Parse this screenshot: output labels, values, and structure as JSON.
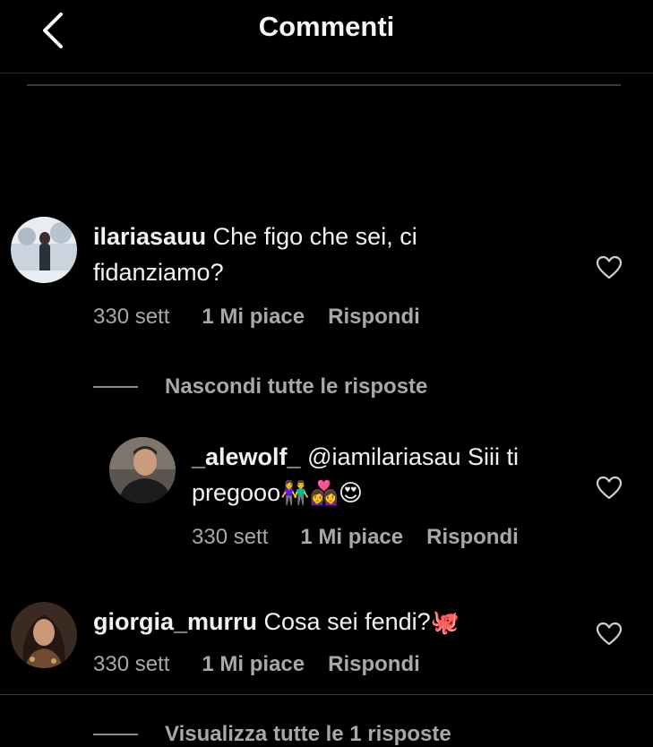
{
  "header": {
    "title": "Commenti"
  },
  "comments": [
    {
      "username": "ilariasauu",
      "text": "Che figo che sei, ci fidanziamo?",
      "time": "330 sett",
      "likes": "1 Mi piace",
      "reply": "Rispondi",
      "replies_toggle": "Nascondi tutte le risposte"
    },
    {
      "username": "_alewolf_",
      "text": "@iamilariasau Siii ti pregooo",
      "emojis": "👫👩‍❤️‍👩😍",
      "time": "330 sett",
      "likes": "1 Mi piace",
      "reply": "Rispondi"
    },
    {
      "username": "giorgia_murru",
      "text": "Cosa sei fendi?",
      "emojis": "🐙",
      "time": "330 sett",
      "likes": "1 Mi piace",
      "reply": "Rispondi",
      "replies_toggle": "Visualizza tutte le 1 risposte"
    }
  ],
  "icons": {
    "back": "chevron-left-icon",
    "like": "heart-outline-icon"
  },
  "colors": {
    "background": "#000000",
    "primary_text": "#f2f2f2",
    "secondary_text": "#a8a8a8"
  }
}
